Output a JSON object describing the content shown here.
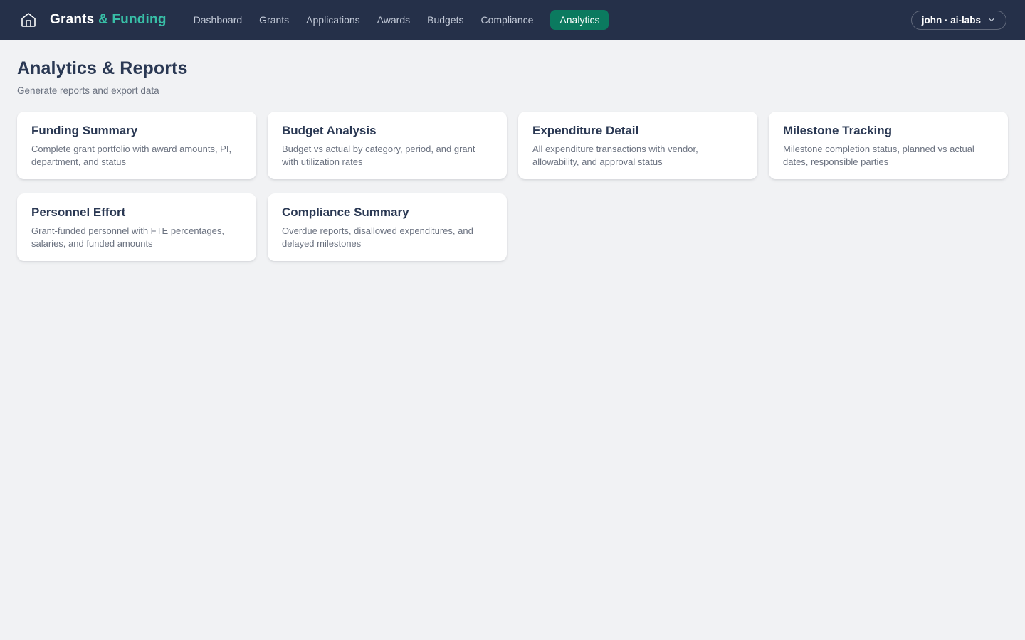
{
  "colors": {
    "navbar_bg": "#253049",
    "accent_teal": "#38bfa7",
    "active_nav_bg": "#0b7a5f",
    "page_bg": "#f1f2f4",
    "heading": "#2a3853"
  },
  "navbar": {
    "logo": {
      "primary": "Grants",
      "accent": "& Funding"
    },
    "items": [
      {
        "label": "Dashboard",
        "active": false
      },
      {
        "label": "Grants",
        "active": false
      },
      {
        "label": "Applications",
        "active": false
      },
      {
        "label": "Awards",
        "active": false
      },
      {
        "label": "Budgets",
        "active": false
      },
      {
        "label": "Compliance",
        "active": false
      },
      {
        "label": "Analytics",
        "active": true
      }
    ],
    "user_menu": {
      "label": "john · ai-labs"
    }
  },
  "page": {
    "title": "Analytics & Reports",
    "subtitle": "Generate reports and export data"
  },
  "reports": [
    {
      "title": "Funding Summary",
      "description": "Complete grant portfolio with award amounts, PI, department, and status"
    },
    {
      "title": "Budget Analysis",
      "description": "Budget vs actual by category, period, and grant with utilization rates"
    },
    {
      "title": "Expenditure Detail",
      "description": "All expenditure transactions with vendor, allowability, and approval status"
    },
    {
      "title": "Milestone Tracking",
      "description": "Milestone completion status, planned vs actual dates, responsible parties"
    },
    {
      "title": "Personnel Effort",
      "description": "Grant-funded personnel with FTE percentages, salaries, and funded amounts"
    },
    {
      "title": "Compliance Summary",
      "description": "Overdue reports, disallowed expenditures, and delayed milestones"
    }
  ]
}
